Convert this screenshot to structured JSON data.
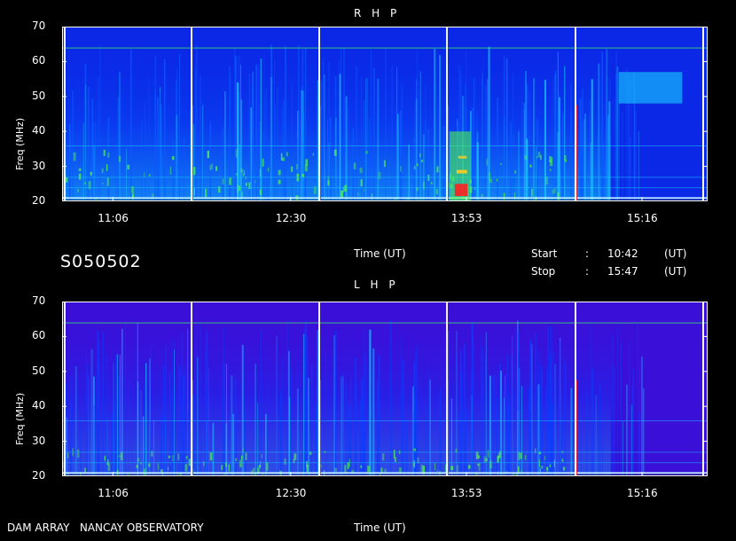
{
  "station": "S050502",
  "footer": {
    "observatory": "DAM ARRAY   NANCAY OBSERVATORY"
  },
  "time_axis_label": "Time (UT)",
  "start": {
    "label": "Start",
    "sep": ":",
    "value": "10:42",
    "unit": "(UT)"
  },
  "stop": {
    "label": "Stop",
    "sep": ":",
    "value": "15:47",
    "unit": "(UT)"
  },
  "chart_data": [
    {
      "type": "heatmap",
      "title": "R H P",
      "xlabel": "Time (UT)",
      "ylabel": "Freq (MHz)",
      "xlim": [
        "10:42",
        "15:47"
      ],
      "ylim": [
        20,
        70
      ],
      "xticks": [
        "11:06",
        "12:30",
        "13:53",
        "15:16"
      ],
      "yticks": [
        20,
        30,
        40,
        50,
        60,
        70
      ],
      "burst_features": [
        {
          "time_start": "13:45",
          "time_end": "13:55",
          "freq_low": 20,
          "freq_high": 40,
          "level": "high"
        },
        {
          "time_start": "15:05",
          "time_end": "15:35",
          "freq_low": 48,
          "freq_high": 57,
          "level": "medium"
        }
      ],
      "colors": {
        "background": "#0a28e6",
        "low": "#0a5aff",
        "mid": "#18d0ff",
        "high": "#50ff40",
        "peak": "#ff2020"
      }
    },
    {
      "type": "heatmap",
      "title": "L H P",
      "xlabel": "Time (UT)",
      "ylabel": "Freq (MHz)",
      "xlim": [
        "10:42",
        "15:47"
      ],
      "ylim": [
        20,
        70
      ],
      "xticks": [
        "11:06",
        "12:30",
        "13:53",
        "15:16"
      ],
      "yticks": [
        20,
        30,
        40,
        50,
        60,
        70
      ],
      "burst_features": [],
      "colors": {
        "background": "#3a10d8",
        "low": "#0a3cff",
        "mid": "#18c0ff",
        "high": "#50ff40",
        "peak": "#ff2020"
      }
    }
  ]
}
